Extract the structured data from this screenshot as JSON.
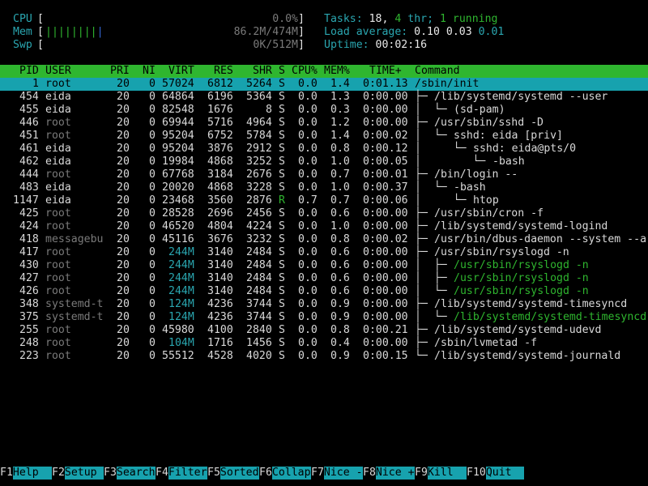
{
  "meters": {
    "cpu": {
      "label": "CPU",
      "value": "0.0%",
      "fraction": 0.0
    },
    "mem": {
      "label": "Mem",
      "value": "86.2M/474M",
      "fraction": 0.18
    },
    "swp": {
      "label": "Swp",
      "value": "0K/512M",
      "fraction": 0.0
    }
  },
  "stats": {
    "tasks_label": "Tasks:",
    "tasks": "18,",
    "thr": "4",
    "thr_label": "thr;",
    "running": "1 running",
    "load_label": "Load average:",
    "load1": "0.10",
    "load5": "0.03",
    "load15": "0.01",
    "uptime_label": "Uptime:",
    "uptime": "00:02:16"
  },
  "columns": [
    "PID",
    "USER",
    "PRI",
    "NI",
    "VIRT",
    "RES",
    "SHR",
    "S",
    "CPU%",
    "MEM%",
    "TIME+",
    "Command"
  ],
  "processes": [
    {
      "pid": "1",
      "user": "root",
      "pri": "20",
      "ni": "0",
      "virt": "57024",
      "res": "6812",
      "shr": "5264",
      "s": "S",
      "cpu": "0.0",
      "mem": "1.4",
      "time": "0:01.13",
      "cmd": "/sbin/init",
      "tree": "",
      "selected": true
    },
    {
      "pid": "454",
      "user": "eida",
      "pri": "20",
      "ni": "0",
      "virt": "64864",
      "res": "6196",
      "shr": "5364",
      "s": "S",
      "cpu": "0.0",
      "mem": "1.3",
      "time": "0:00.00",
      "cmd": "/lib/systemd/systemd --user",
      "tree": "├─ "
    },
    {
      "pid": "455",
      "user": "eida",
      "pri": "20",
      "ni": "0",
      "virt": "82548",
      "res": "1676",
      "shr": "8",
      "s": "S",
      "cpu": "0.0",
      "mem": "0.3",
      "time": "0:00.00",
      "cmd": "(sd-pam)",
      "tree": "│  └─ "
    },
    {
      "pid": "446",
      "user": "root",
      "pri": "20",
      "ni": "0",
      "virt": "69944",
      "res": "5716",
      "shr": "4964",
      "s": "S",
      "cpu": "0.0",
      "mem": "1.2",
      "time": "0:00.00",
      "cmd": "/usr/sbin/sshd -D",
      "tree": "├─ "
    },
    {
      "pid": "451",
      "user": "root",
      "pri": "20",
      "ni": "0",
      "virt": "95204",
      "res": "6752",
      "shr": "5784",
      "s": "S",
      "cpu": "0.0",
      "mem": "1.4",
      "time": "0:00.02",
      "cmd": "sshd: eida [priv]",
      "tree": "│  └─ "
    },
    {
      "pid": "461",
      "user": "eida",
      "pri": "20",
      "ni": "0",
      "virt": "95204",
      "res": "3876",
      "shr": "2912",
      "s": "S",
      "cpu": "0.0",
      "mem": "0.8",
      "time": "0:00.12",
      "cmd": "sshd: eida@pts/0",
      "tree": "│     └─ "
    },
    {
      "pid": "462",
      "user": "eida",
      "pri": "20",
      "ni": "0",
      "virt": "19984",
      "res": "4868",
      "shr": "3252",
      "s": "S",
      "cpu": "0.0",
      "mem": "1.0",
      "time": "0:00.05",
      "cmd": "-bash",
      "tree": "│        └─ "
    },
    {
      "pid": "444",
      "user": "root",
      "pri": "20",
      "ni": "0",
      "virt": "67768",
      "res": "3184",
      "shr": "2676",
      "s": "S",
      "cpu": "0.0",
      "mem": "0.7",
      "time": "0:00.01",
      "cmd": "/bin/login --",
      "tree": "├─ "
    },
    {
      "pid": "483",
      "user": "eida",
      "pri": "20",
      "ni": "0",
      "virt": "20020",
      "res": "4868",
      "shr": "3228",
      "s": "S",
      "cpu": "0.0",
      "mem": "1.0",
      "time": "0:00.37",
      "cmd": "-bash",
      "tree": "│  └─ "
    },
    {
      "pid": "1147",
      "user": "eida",
      "pri": "20",
      "ni": "0",
      "virt": "23468",
      "res": "3560",
      "shr": "2876",
      "s": "R",
      "cpu": "0.7",
      "mem": "0.7",
      "time": "0:00.06",
      "cmd": "htop",
      "tree": "│     └─ "
    },
    {
      "pid": "425",
      "user": "root",
      "pri": "20",
      "ni": "0",
      "virt": "28528",
      "res": "2696",
      "shr": "2456",
      "s": "S",
      "cpu": "0.0",
      "mem": "0.6",
      "time": "0:00.00",
      "cmd": "/usr/sbin/cron -f",
      "tree": "├─ "
    },
    {
      "pid": "424",
      "user": "root",
      "pri": "20",
      "ni": "0",
      "virt": "46520",
      "res": "4804",
      "shr": "4224",
      "s": "S",
      "cpu": "0.0",
      "mem": "1.0",
      "time": "0:00.00",
      "cmd": "/lib/systemd/systemd-logind",
      "tree": "├─ "
    },
    {
      "pid": "418",
      "user": "messagebu",
      "pri": "20",
      "ni": "0",
      "virt": "45116",
      "res": "3676",
      "shr": "3232",
      "s": "S",
      "cpu": "0.0",
      "mem": "0.8",
      "time": "0:00.02",
      "cmd": "/usr/bin/dbus-daemon --system --a",
      "tree": "├─ "
    },
    {
      "pid": "417",
      "user": "root",
      "pri": "20",
      "ni": "0",
      "virt": "244M",
      "res": "3140",
      "shr": "2484",
      "s": "S",
      "cpu": "0.0",
      "mem": "0.6",
      "time": "0:00.00",
      "cmd": "/usr/sbin/rsyslogd -n",
      "tree": "├─ "
    },
    {
      "pid": "430",
      "user": "root",
      "pri": "20",
      "ni": "0",
      "virt": "244M",
      "res": "3140",
      "shr": "2484",
      "s": "S",
      "cpu": "0.0",
      "mem": "0.6",
      "time": "0:00.00",
      "cmd": "/usr/sbin/rsyslogd -n",
      "tree": "│  ├─ ",
      "thread": true
    },
    {
      "pid": "427",
      "user": "root",
      "pri": "20",
      "ni": "0",
      "virt": "244M",
      "res": "3140",
      "shr": "2484",
      "s": "S",
      "cpu": "0.0",
      "mem": "0.6",
      "time": "0:00.00",
      "cmd": "/usr/sbin/rsyslogd -n",
      "tree": "│  ├─ ",
      "thread": true
    },
    {
      "pid": "426",
      "user": "root",
      "pri": "20",
      "ni": "0",
      "virt": "244M",
      "res": "3140",
      "shr": "2484",
      "s": "S",
      "cpu": "0.0",
      "mem": "0.6",
      "time": "0:00.00",
      "cmd": "/usr/sbin/rsyslogd -n",
      "tree": "│  └─ ",
      "thread": true
    },
    {
      "pid": "348",
      "user": "systemd-t",
      "pri": "20",
      "ni": "0",
      "virt": "124M",
      "res": "4236",
      "shr": "3744",
      "s": "S",
      "cpu": "0.0",
      "mem": "0.9",
      "time": "0:00.00",
      "cmd": "/lib/systemd/systemd-timesyncd",
      "tree": "├─ "
    },
    {
      "pid": "375",
      "user": "systemd-t",
      "pri": "20",
      "ni": "0",
      "virt": "124M",
      "res": "4236",
      "shr": "3744",
      "s": "S",
      "cpu": "0.0",
      "mem": "0.9",
      "time": "0:00.00",
      "cmd": "/lib/systemd/systemd-timesyncd",
      "tree": "│  └─ ",
      "thread": true
    },
    {
      "pid": "255",
      "user": "root",
      "pri": "20",
      "ni": "0",
      "virt": "45980",
      "res": "4100",
      "shr": "2840",
      "s": "S",
      "cpu": "0.0",
      "mem": "0.8",
      "time": "0:00.21",
      "cmd": "/lib/systemd/systemd-udevd",
      "tree": "├─ "
    },
    {
      "pid": "248",
      "user": "root",
      "pri": "20",
      "ni": "0",
      "virt": "104M",
      "res": "1716",
      "shr": "1456",
      "s": "S",
      "cpu": "0.0",
      "mem": "0.4",
      "time": "0:00.00",
      "cmd": "/sbin/lvmetad -f",
      "tree": "├─ "
    },
    {
      "pid": "223",
      "user": "root",
      "pri": "20",
      "ni": "0",
      "virt": "55512",
      "res": "4528",
      "shr": "4020",
      "s": "S",
      "cpu": "0.0",
      "mem": "0.9",
      "time": "0:00.15",
      "cmd": "/lib/systemd/systemd-journald",
      "tree": "└─ "
    }
  ],
  "fkeys": [
    {
      "key": "F1",
      "label": "Help  "
    },
    {
      "key": "F2",
      "label": "Setup "
    },
    {
      "key": "F3",
      "label": "Search"
    },
    {
      "key": "F4",
      "label": "Filter"
    },
    {
      "key": "F5",
      "label": "Sorted"
    },
    {
      "key": "F6",
      "label": "Collap"
    },
    {
      "key": "F7",
      "label": "Nice -"
    },
    {
      "key": "F8",
      "label": "Nice +"
    },
    {
      "key": "F9",
      "label": "Kill  "
    },
    {
      "key": "F10",
      "label": "Quit  "
    }
  ],
  "colors": {
    "header_bg": "#2fb62f",
    "selection_bg": "#17a2ae",
    "thread": "#2fb62f",
    "root_user": "#7a7a7a"
  }
}
